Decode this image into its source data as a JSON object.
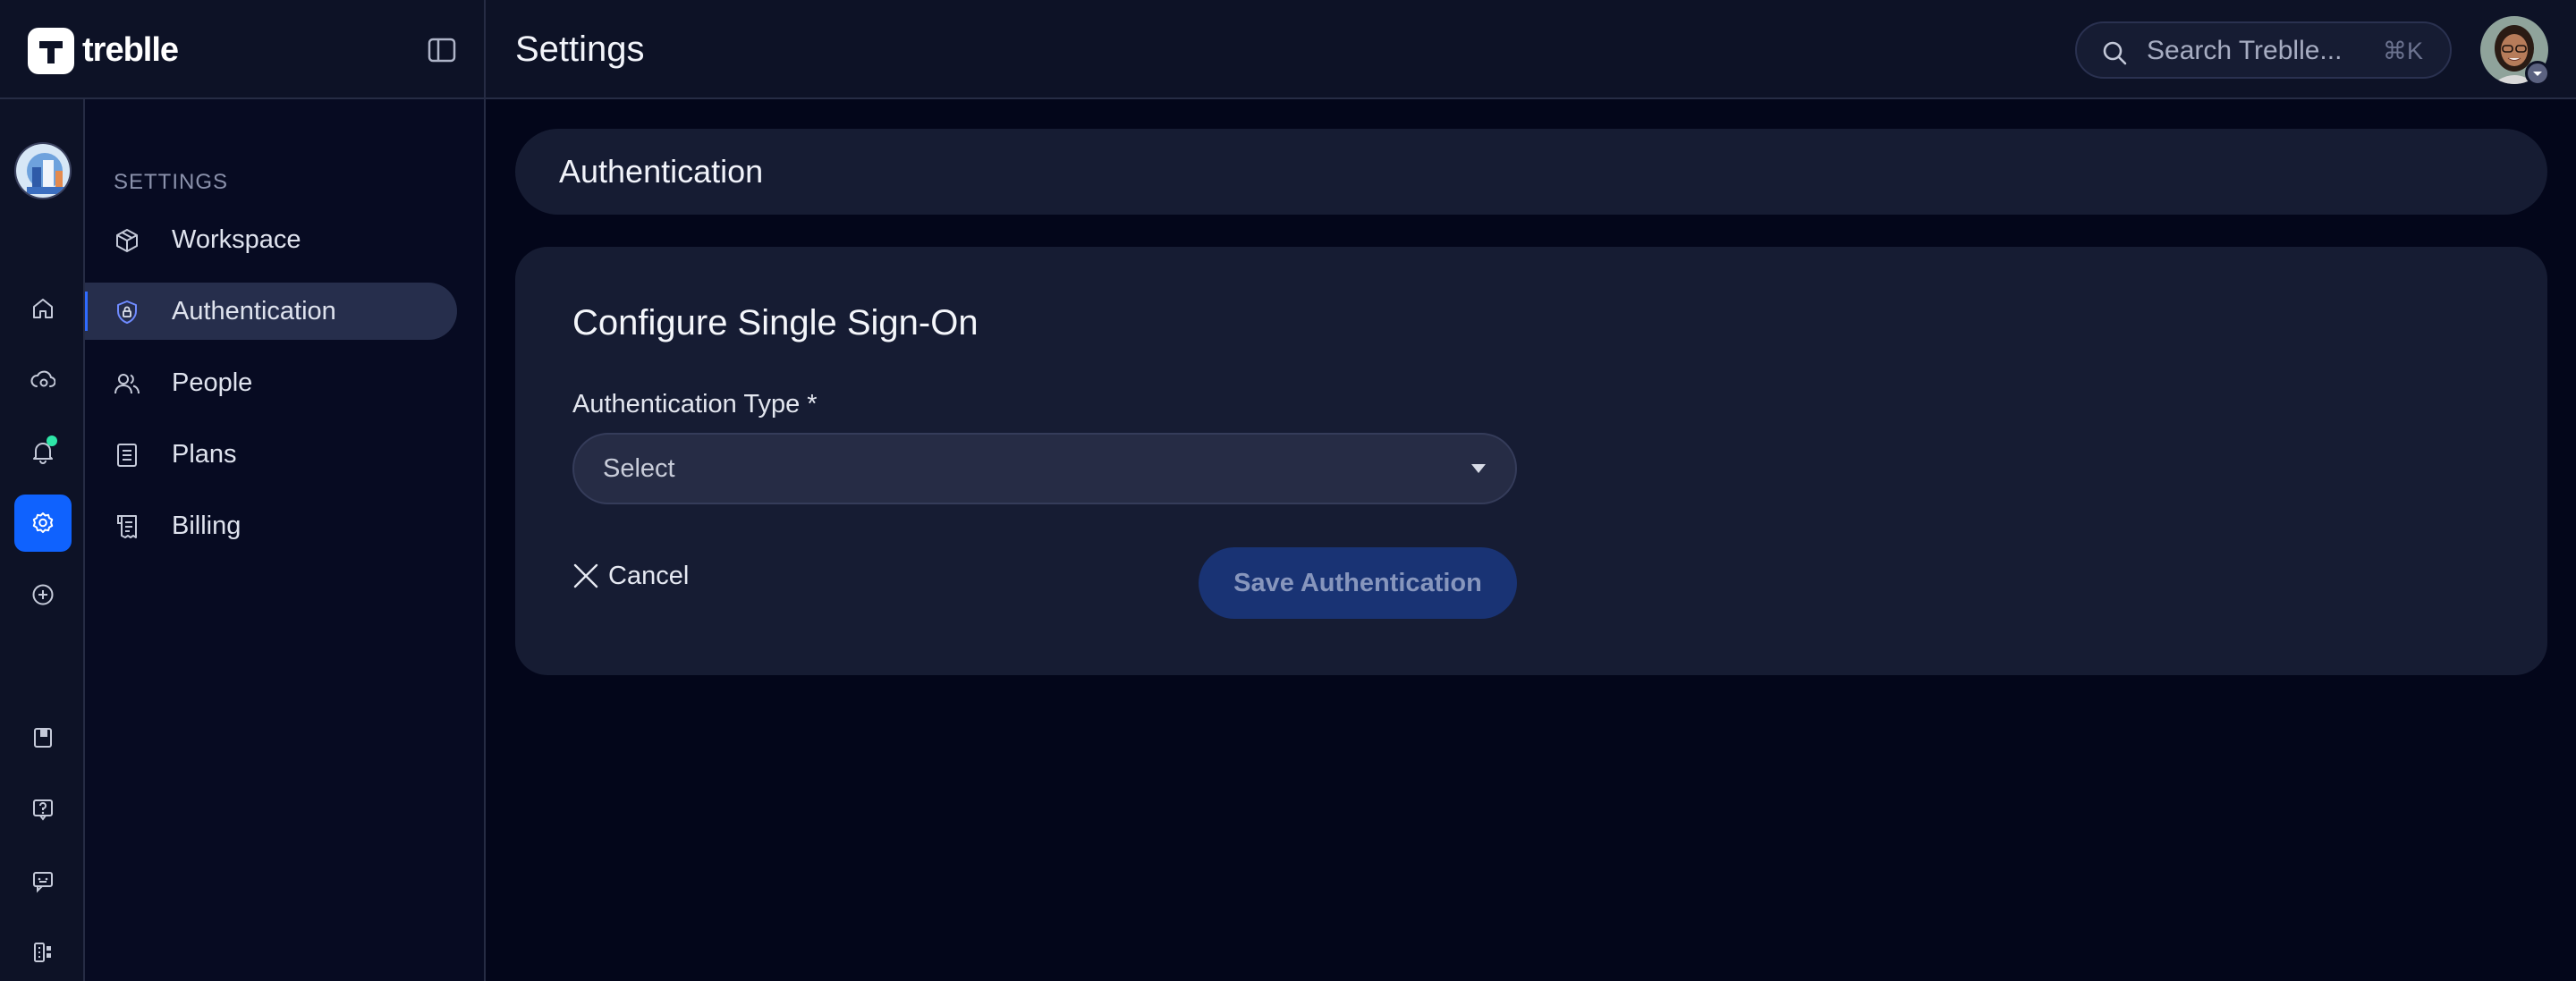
{
  "app": {
    "brand_name": "treblle",
    "page_title": "Settings"
  },
  "search": {
    "placeholder": "Search Treblle...",
    "shortcut": "⌘K"
  },
  "rail": {
    "items": [
      {
        "name": "home",
        "icon": "home-icon"
      },
      {
        "name": "api-dashboard",
        "icon": "cloud-gear-icon"
      },
      {
        "name": "notifications",
        "icon": "bell-icon",
        "has_indicator": true
      },
      {
        "name": "settings",
        "icon": "gear-icon",
        "active": true
      },
      {
        "name": "add",
        "icon": "plus-circle-icon"
      },
      {
        "name": "docs",
        "icon": "book-icon"
      },
      {
        "name": "help",
        "icon": "help-icon"
      },
      {
        "name": "feedback",
        "icon": "chat-icon"
      },
      {
        "name": "apps",
        "icon": "apps-icon"
      }
    ]
  },
  "sidebar": {
    "heading": "SETTINGS",
    "items": [
      {
        "label": "Workspace",
        "icon": "cube-icon",
        "active": false
      },
      {
        "label": "Authentication",
        "icon": "shield-lock-icon",
        "active": true
      },
      {
        "label": "People",
        "icon": "people-icon",
        "active": false
      },
      {
        "label": "Plans",
        "icon": "document-icon",
        "active": false
      },
      {
        "label": "Billing",
        "icon": "receipt-icon",
        "active": false
      }
    ]
  },
  "main": {
    "section_title": "Authentication",
    "card": {
      "title": "Configure Single Sign-On",
      "field_label": "Authentication Type *",
      "select_value": "Select",
      "cancel_label": "Cancel",
      "save_label": "Save Authentication"
    }
  },
  "colors": {
    "background": "#03061a",
    "panel": "#161c33",
    "accent": "#0f62fe",
    "save_button": "#193374",
    "indicator": "#2ee6a8"
  }
}
